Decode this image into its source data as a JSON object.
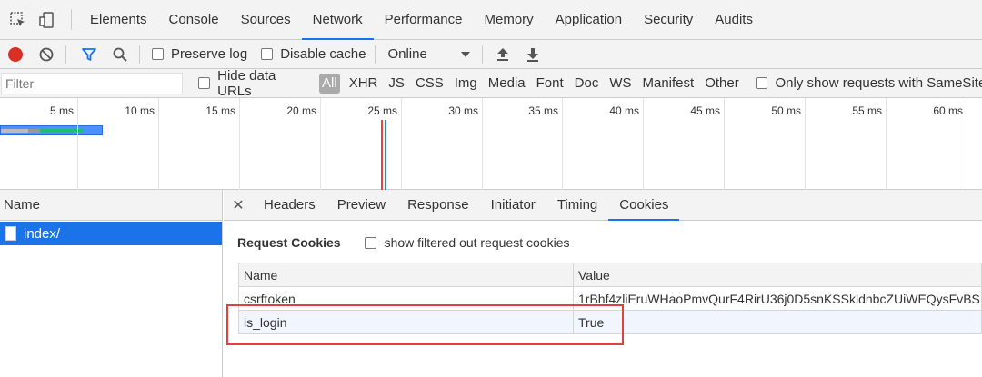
{
  "devtools": {
    "tabs": [
      "Elements",
      "Console",
      "Sources",
      "Network",
      "Performance",
      "Memory",
      "Application",
      "Security",
      "Audits"
    ],
    "active_tab": "Network"
  },
  "network_toolbar": {
    "preserve_log": "Preserve log",
    "disable_cache": "Disable cache",
    "throttle": "Online"
  },
  "filter_bar": {
    "placeholder": "Filter",
    "hide_data_urls": "Hide data URLs",
    "types": [
      "All",
      "XHR",
      "JS",
      "CSS",
      "Img",
      "Media",
      "Font",
      "Doc",
      "WS",
      "Manifest",
      "Other"
    ],
    "active_type": "All",
    "samesite": "Only show requests with SameSite"
  },
  "timeline": {
    "ticks": [
      "5 ms",
      "10 ms",
      "15 ms",
      "20 ms",
      "25 ms",
      "30 ms",
      "35 ms",
      "40 ms",
      "45 ms",
      "50 ms",
      "55 ms",
      "60 ms"
    ]
  },
  "request_list": {
    "header": "Name",
    "items": [
      "index/"
    ]
  },
  "detail": {
    "tabs": [
      "Headers",
      "Preview",
      "Response",
      "Initiator",
      "Timing",
      "Cookies"
    ],
    "active_tab": "Cookies",
    "section_title": "Request Cookies",
    "show_filtered": "show filtered out request cookies",
    "columns": [
      "Name",
      "Value"
    ],
    "cookies": [
      {
        "name": "csrftoken",
        "value": "1rBhf4zliEruWHaoPmvQurF4RirU36j0D5snKSSkldnbcZUiWEQysFvBS"
      },
      {
        "name": "is_login",
        "value": "True"
      }
    ]
  },
  "colors": {
    "accent": "#1a73e8",
    "record": "#d93025",
    "highlight": "#e04040"
  }
}
